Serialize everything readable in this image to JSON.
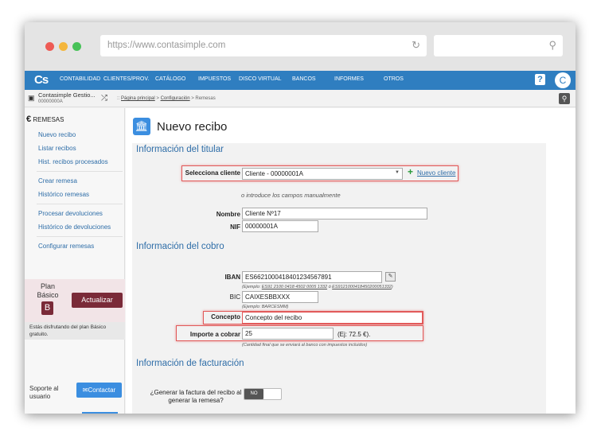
{
  "browser": {
    "url": "https://www.contasimple.com"
  },
  "nav": {
    "logo": "Cs",
    "items": [
      "CONTABILIDAD",
      "CLIENTES/PROV.",
      "CATÁLOGO",
      "IMPUESTOS",
      "DISCO VIRTUAL",
      "BANCOS",
      "INFORMES",
      "OTROS"
    ],
    "help": "?",
    "avatar": "C"
  },
  "subbar": {
    "company": "Contasimple Gestio...",
    "company_nif": "00000000A",
    "breadcrumb_sep1": ":: ",
    "crumb1": "Página principal",
    "crumb_sep": " > ",
    "crumb2": "Configuración",
    "crumb3": " > Remesas"
  },
  "sidebar": {
    "section_title": "REMESAS",
    "links": [
      "Nuevo recibo",
      "Listar recibos",
      "Hist. recibos procesados",
      "Crear remesa",
      "Histórico remesas",
      "Procesar devoluciones",
      "Histórico de devoluciones",
      "Configurar remesas"
    ],
    "plan_label": "Plan Básico",
    "plan_badge": "B",
    "upgrade_button": "Actualizar",
    "plan_message": "Estás disfrutando del plan Básico gratuito.",
    "support_label": "Soporte al usuario",
    "contact_button": "Contactar"
  },
  "page": {
    "title": "Nuevo recibo"
  },
  "titular": {
    "heading": "Información del titular",
    "client_label": "Selecciona cliente",
    "client_value": "Cliente - 00000001A",
    "new_client": "Nuevo cliente",
    "or_text": "o introduce los campos manualmente",
    "name_label": "Nombre",
    "name_value": "Cliente Nº17",
    "nif_label": "NIF",
    "nif_value": "00000001A"
  },
  "cobro": {
    "heading": "Información del cobro",
    "iban_label": "IBAN",
    "iban_value": "ES6621000418401234567891",
    "iban_hint_prefix": "(Ejemplo: ",
    "iban_example1": "ES91 2100 0418 4502 0005 1332",
    "iban_hint_mid": "  ó  ",
    "iban_example2": "ES9121000418450200051332",
    "iban_hint_suffix": ")",
    "bic_label": "BIC",
    "bic_value": "CAIXESBBXXX",
    "bic_hint": "(Ejemplo: BARCESMM)",
    "concept_label": "Concepto",
    "concept_value": "Concepto del recibo",
    "amount_label": "Importe a cobrar",
    "amount_value": "25",
    "amount_example": "(Ej: 72.5 €).",
    "amount_hint": "(Cantidad final que se enviará al banco con impuestos incluidos)"
  },
  "facturacion": {
    "heading": "Información de facturación",
    "question": "¿Generar la factura del recibo al generar la remesa?",
    "toggle_value": "NO"
  },
  "colors": {
    "brand": "#2f7ec0",
    "plan": "#7a2a38",
    "highlight": "#e25a5a"
  }
}
